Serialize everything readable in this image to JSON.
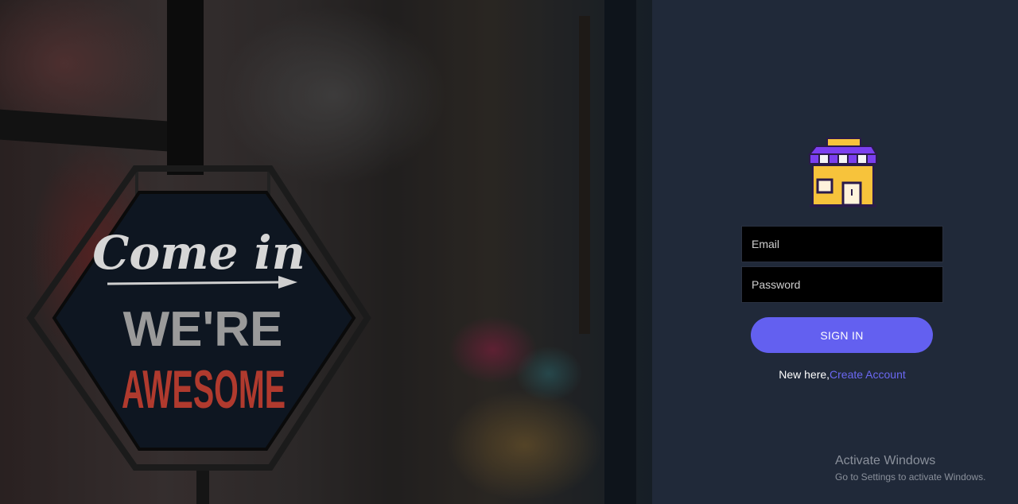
{
  "hero": {
    "sign_line1": "Come in",
    "sign_line2": "WE'RE",
    "sign_line3": "AWESOME"
  },
  "login": {
    "logo_icon": "storefront-icon",
    "email_placeholder": "Email",
    "password_placeholder": "Password",
    "signin_label": "SIGN IN",
    "new_here_text": "New here,",
    "create_account_link": "Create Account",
    "accent_color": "#6360f0",
    "background_color": "#202939"
  },
  "watermark": {
    "title": "Activate Windows",
    "subtitle": "Go to Settings to activate Windows."
  }
}
